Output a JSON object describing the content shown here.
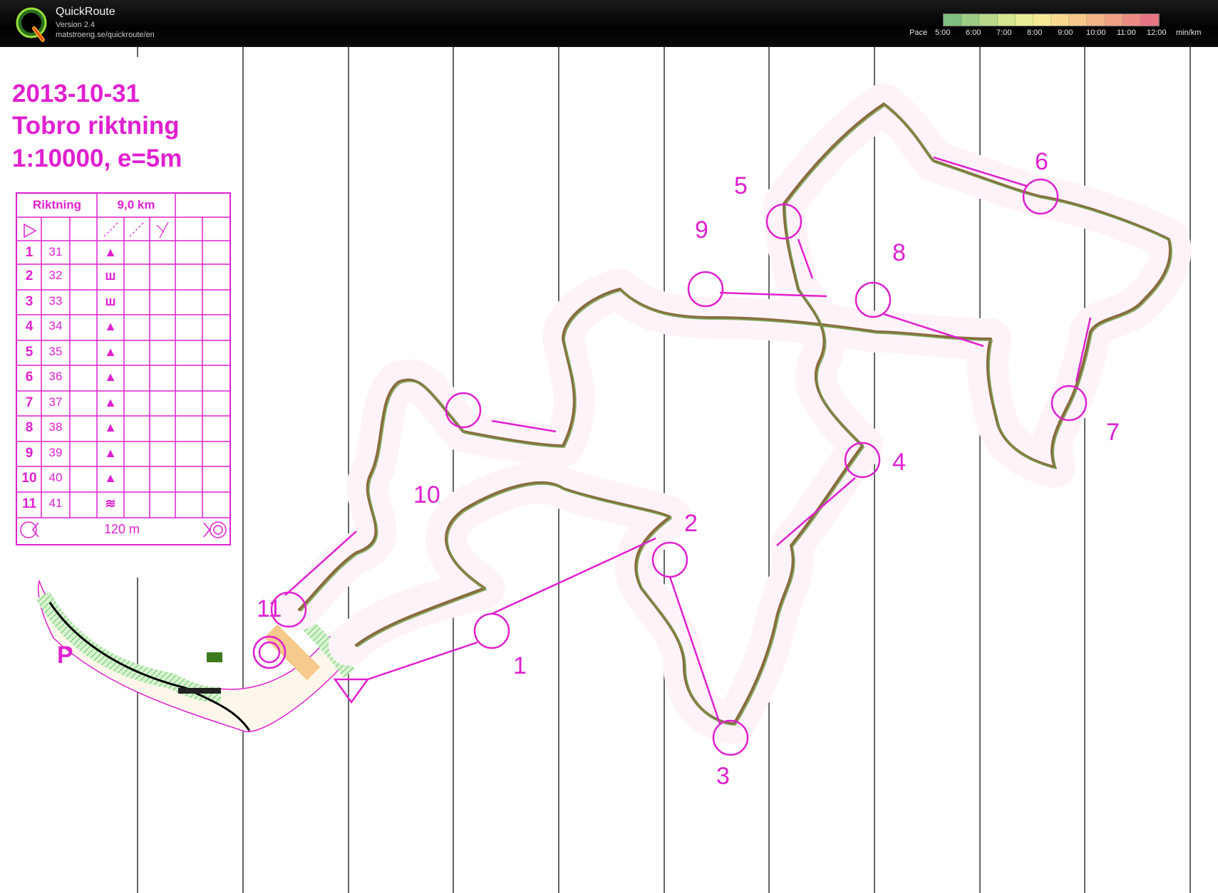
{
  "app": {
    "name": "QuickRoute",
    "version": "Version 2.4",
    "url": "matstroeng.se/quickroute/en"
  },
  "pace_scale": {
    "label": "Pace",
    "ticks": [
      "5:00",
      "6:00",
      "7:00",
      "8:00",
      "9:00",
      "10:00",
      "11:00",
      "12:00"
    ],
    "unit": "min/km",
    "colors": [
      "#7fbf7f",
      "#9ccc84",
      "#b8d98a",
      "#d4e690",
      "#e9ee96",
      "#f6e993",
      "#f8d98e",
      "#f7c88a",
      "#f4b586",
      "#f0a184",
      "#ec8a84",
      "#e87382"
    ]
  },
  "map": {
    "title": [
      "2013-10-31",
      "Tobro riktning",
      "1:10000, e=5m"
    ],
    "colors": {
      "overprint": "#e020d0",
      "route": "#7a6a55",
      "vegetation": "#8fd98f",
      "open": "#f6c98c"
    },
    "start_label": "P",
    "controls": [
      "1",
      "2",
      "3",
      "4",
      "5",
      "6",
      "7",
      "8",
      "9",
      "10",
      "11"
    ]
  },
  "legend": {
    "course": "Riktning",
    "length": "9,0 km",
    "rows": [
      {
        "num": "1",
        "code": "31",
        "symbol": "▲"
      },
      {
        "num": "2",
        "code": "32",
        "symbol": "ш"
      },
      {
        "num": "3",
        "code": "33",
        "symbol": "ш"
      },
      {
        "num": "4",
        "code": "34",
        "symbol": "▲"
      },
      {
        "num": "5",
        "code": "35",
        "symbol": "▲"
      },
      {
        "num": "6",
        "code": "36",
        "symbol": "▲"
      },
      {
        "num": "7",
        "code": "37",
        "symbol": "▲"
      },
      {
        "num": "8",
        "code": "38",
        "symbol": "▲"
      },
      {
        "num": "9",
        "code": "39",
        "symbol": "▲"
      },
      {
        "num": "10",
        "code": "40",
        "symbol": "▲"
      },
      {
        "num": "11",
        "code": "41",
        "symbol": "≋"
      }
    ],
    "finish_distance": "120 m"
  }
}
